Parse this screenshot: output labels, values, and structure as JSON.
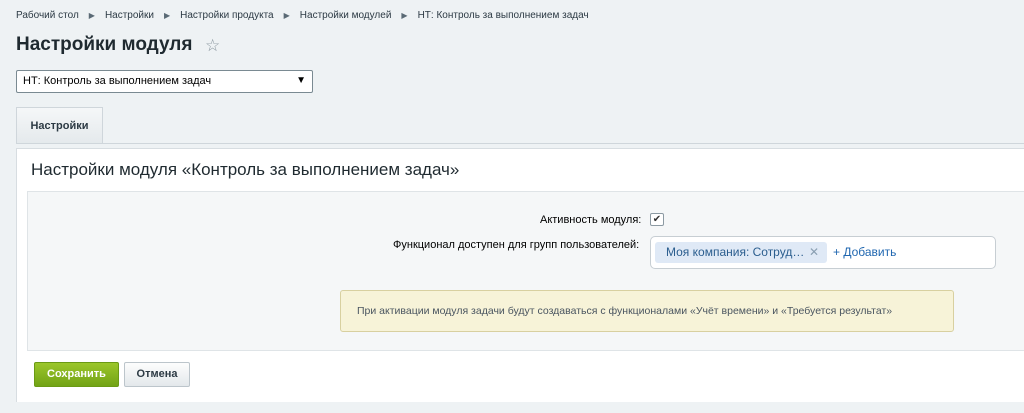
{
  "breadcrumb": [
    {
      "label": "Рабочий стол"
    },
    {
      "label": "Настройки"
    },
    {
      "label": "Настройки продукта"
    },
    {
      "label": "Настройки модулей"
    },
    {
      "label": "НТ: Контроль за выполнением задач"
    }
  ],
  "page": {
    "title": "Настройки модуля"
  },
  "module_select": {
    "value": "НТ: Контроль за выполнением задач"
  },
  "tabs": [
    {
      "label": "Настройки"
    }
  ],
  "panel": {
    "title": "Настройки модуля «Контроль за выполнением задач»"
  },
  "form": {
    "active_label": "Активность модуля:",
    "active_checked": true,
    "groups_label": "Функционал доступен для групп пользователей:",
    "groups_tag": "Моя компания: Сотруд…",
    "add_link": "+ Добавить"
  },
  "notice": {
    "text": "При активации модуля задачи будут создаваться с функционалами «Учёт времени» и «Требуется результат»"
  },
  "buttons": {
    "save": "Сохранить",
    "cancel": "Отмена"
  }
}
